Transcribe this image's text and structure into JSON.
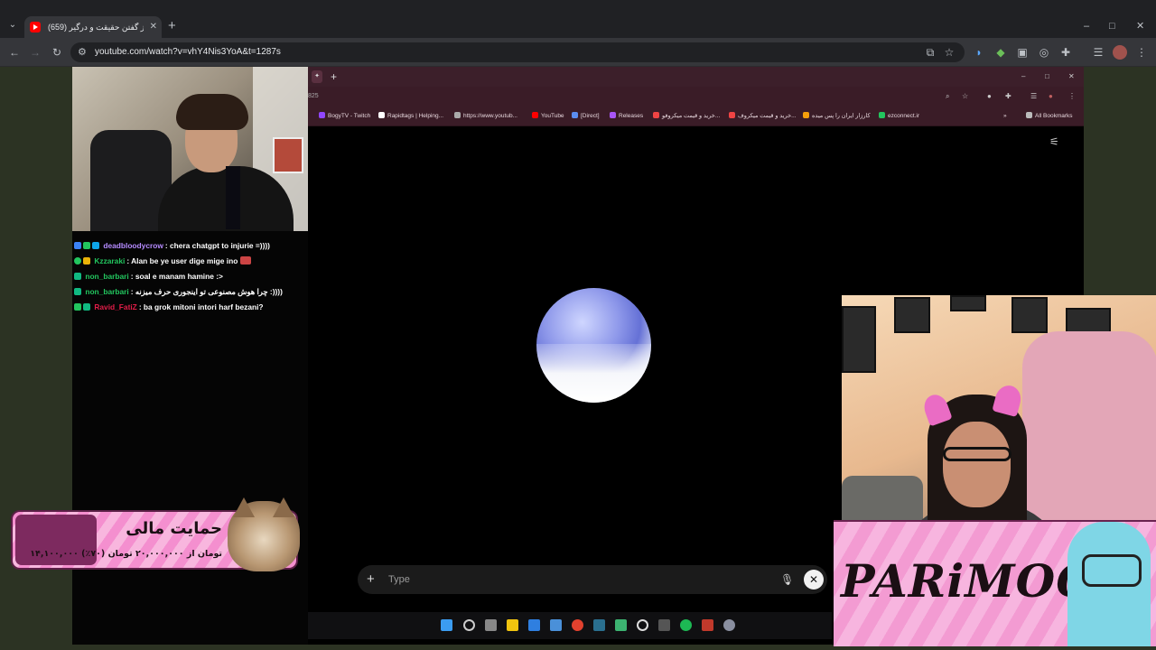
{
  "browser": {
    "tab_title": "(659) از گفتن حقیقت و درگیر",
    "url": "youtube.com/watch?v=vhY4Nis3YoA&t=1287s",
    "window_controls": [
      "–",
      "□",
      "✕"
    ]
  },
  "stream": {
    "chat": [
      {
        "user": "deadbloodycrow",
        "user_color": "#b58bff",
        "message": ": chera chatgpt to injurie =))))",
        "badge_colors": [
          "#3b82f6",
          "#22c55e",
          "#0ea5e9"
        ],
        "emote": false
      },
      {
        "user": "Kzzaraki",
        "user_color": "#22c55e",
        "message": ": Alan be ye user dige mige ino",
        "badge_colors": [
          "#22c55e",
          "#eab308"
        ],
        "emote": true
      },
      {
        "user": "non_barbari",
        "user_color": "#22c55e",
        "message": ": soal e manam hamine :>",
        "badge_colors": [
          "#10b981"
        ],
        "emote": false
      },
      {
        "user": "non_barbari",
        "user_color": "#22c55e",
        "message": ": چرا هوش مصنوعی تو اینجوری حرف میزنه :))))",
        "badge_colors": [
          "#10b981"
        ],
        "emote": false
      },
      {
        "user": "Ravid_FatiZ",
        "user_color": "#e11d48",
        "message": ": ba grok mitoni intori harf bezani?",
        "badge_colors": [
          "#22c55e",
          "#10b981"
        ],
        "emote": false
      }
    ]
  },
  "inner_browser": {
    "url_fragment": "825",
    "bookmarks": [
      {
        "label": "BogyTV - Twitch",
        "color": "#9146ff"
      },
      {
        "label": "Rapidtags | Helping...",
        "color": "#ffffff"
      },
      {
        "label": "https://www.youtub...",
        "color": "#aaaaaa"
      },
      {
        "label": "YouTube",
        "color": "#ff0000"
      },
      {
        "label": "[Direct]",
        "color": "#5b8def"
      },
      {
        "label": "Releases",
        "color": "#a855f7"
      },
      {
        "label": "خرید و قیمت میکروفو...",
        "color": "#ef4444"
      },
      {
        "label": "خرید و قیمت میکروف...",
        "color": "#ef4444"
      },
      {
        "label": "کارزار ایران را پس میده",
        "color": "#f59e0b"
      },
      {
        "label": "ezconnect.ir",
        "color": "#22c55e"
      }
    ],
    "all_bookmarks": "All Bookmarks",
    "input_placeholder": "Type"
  },
  "donation": {
    "title": "حمایت مالی",
    "subtitle": "۱۴,۱۰۰,۰۰۰ تومان از ۲۰,۰۰۰,۰۰۰ تومان (۷۰٪)"
  },
  "branding": {
    "name": "PARiMOON"
  }
}
